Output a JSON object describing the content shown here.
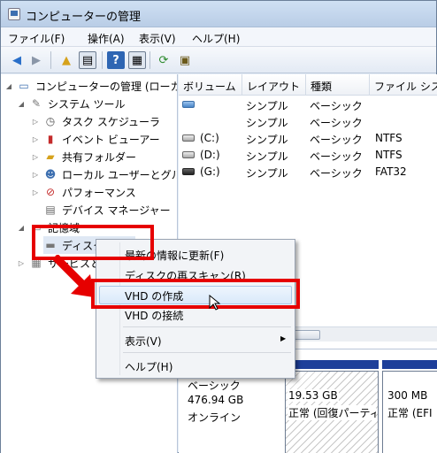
{
  "window": {
    "title": "コンピューターの管理"
  },
  "menubar": {
    "items": [
      "ファイル(F)",
      "操作(A)",
      "表示(V)",
      "ヘルプ(H)"
    ]
  },
  "toolbar": {
    "icons": [
      "back-arrow-icon",
      "forward-arrow-icon",
      "up-folder-icon",
      "console-tree-icon",
      "help-icon",
      "properties-icon",
      "refresh-icon",
      "export-list-icon"
    ]
  },
  "tree": {
    "root": "コンピューターの管理 (ローカル)",
    "system_tools": "システム ツール",
    "task_scheduler": "タスク スケジューラ",
    "event_viewer": "イベント ビューアー",
    "shared_folders": "共有フォルダー",
    "local_users": "ローカル ユーザーとグループ",
    "performance": "パフォーマンス",
    "device_manager": "デバイス マネージャー",
    "storage": "記憶域",
    "disk_management": "ディスクの管理",
    "services": "サービスとアプリケーション"
  },
  "list": {
    "columns": [
      "ボリューム",
      "レイアウト",
      "種類",
      "ファイル システム"
    ],
    "rows": [
      {
        "volume": "",
        "layout": "シンプル",
        "type": "ベーシック",
        "fs": ""
      },
      {
        "volume": "",
        "layout": "シンプル",
        "type": "ベーシック",
        "fs": ""
      },
      {
        "volume": "(C:)",
        "layout": "シンプル",
        "type": "ベーシック",
        "fs": "NTFS"
      },
      {
        "volume": "(D:)",
        "layout": "シンプル",
        "type": "ベーシック",
        "fs": "NTFS"
      },
      {
        "volume": "(G:)",
        "layout": "シンプル",
        "type": "ベーシック",
        "fs": "FAT32"
      }
    ]
  },
  "diskmap": {
    "disk_type": "ベーシック",
    "disk_size": "476.94 GB",
    "disk_status": "オンライン",
    "part1_size": "19.53 GB",
    "part1_status": "正常 (回復パーティション)",
    "part2_size": "300 MB",
    "part2_status": "正常 (EFI"
  },
  "context_menu": {
    "items": [
      "最新の情報に更新(F)",
      "ディスクの再スキャン(R)",
      "VHD の作成",
      "VHD の接続",
      "表示(V)",
      "ヘルプ(H)"
    ],
    "highlighted": "VHD の作成"
  },
  "colors": {
    "annotation_red": "#e60000",
    "partition_bar": "#1e3f9a"
  }
}
